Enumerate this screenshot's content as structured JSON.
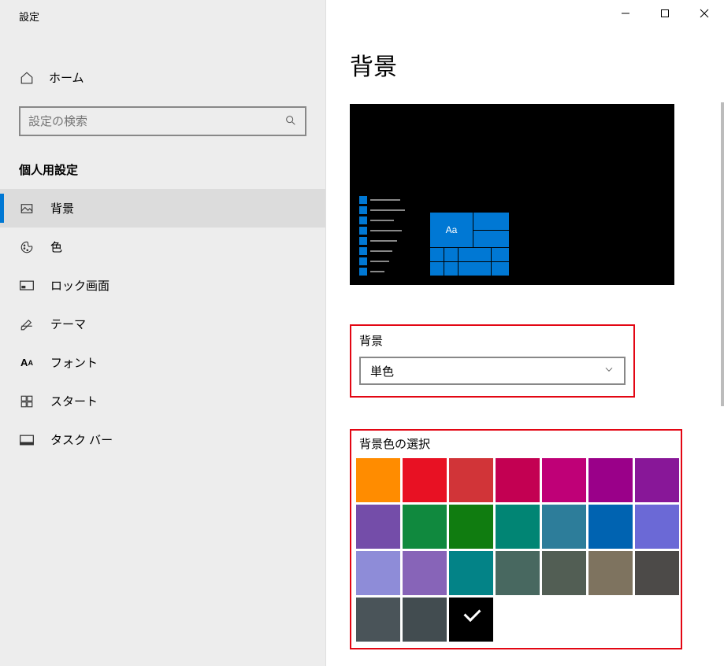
{
  "window": {
    "title": "設定"
  },
  "sidebar": {
    "home_label": "ホーム",
    "search_placeholder": "設定の検索",
    "category_label": "個人用設定",
    "items": [
      {
        "label": "背景",
        "icon": "picture-icon",
        "active": true
      },
      {
        "label": "色",
        "icon": "palette-icon"
      },
      {
        "label": "ロック画面",
        "icon": "monitor-icon"
      },
      {
        "label": "テーマ",
        "icon": "brush-icon"
      },
      {
        "label": "フォント",
        "icon": "font-icon"
      },
      {
        "label": "スタート",
        "icon": "grid-icon"
      },
      {
        "label": "タスク バー",
        "icon": "taskbar-icon"
      }
    ]
  },
  "main": {
    "heading": "背景",
    "preview_tile_text": "Aa",
    "bg_section_label": "背景",
    "bg_dropdown_value": "単色",
    "color_section_label": "背景色の選択",
    "colors": [
      "#ff8c00",
      "#e81123",
      "#d13438",
      "#c30052",
      "#bf0077",
      "#9a0089",
      "#881798",
      "#744da9",
      "#10893e",
      "#107c10",
      "#018574",
      "#2d7d9a",
      "#0063b1",
      "#6b69d6",
      "#8e8cd8",
      "#8764b8",
      "#038387",
      "#486860",
      "#525e54",
      "#7e735f",
      "#4c4a48",
      "#4a5459",
      "#424c50",
      "#000000"
    ],
    "selected_color_index": 23
  }
}
